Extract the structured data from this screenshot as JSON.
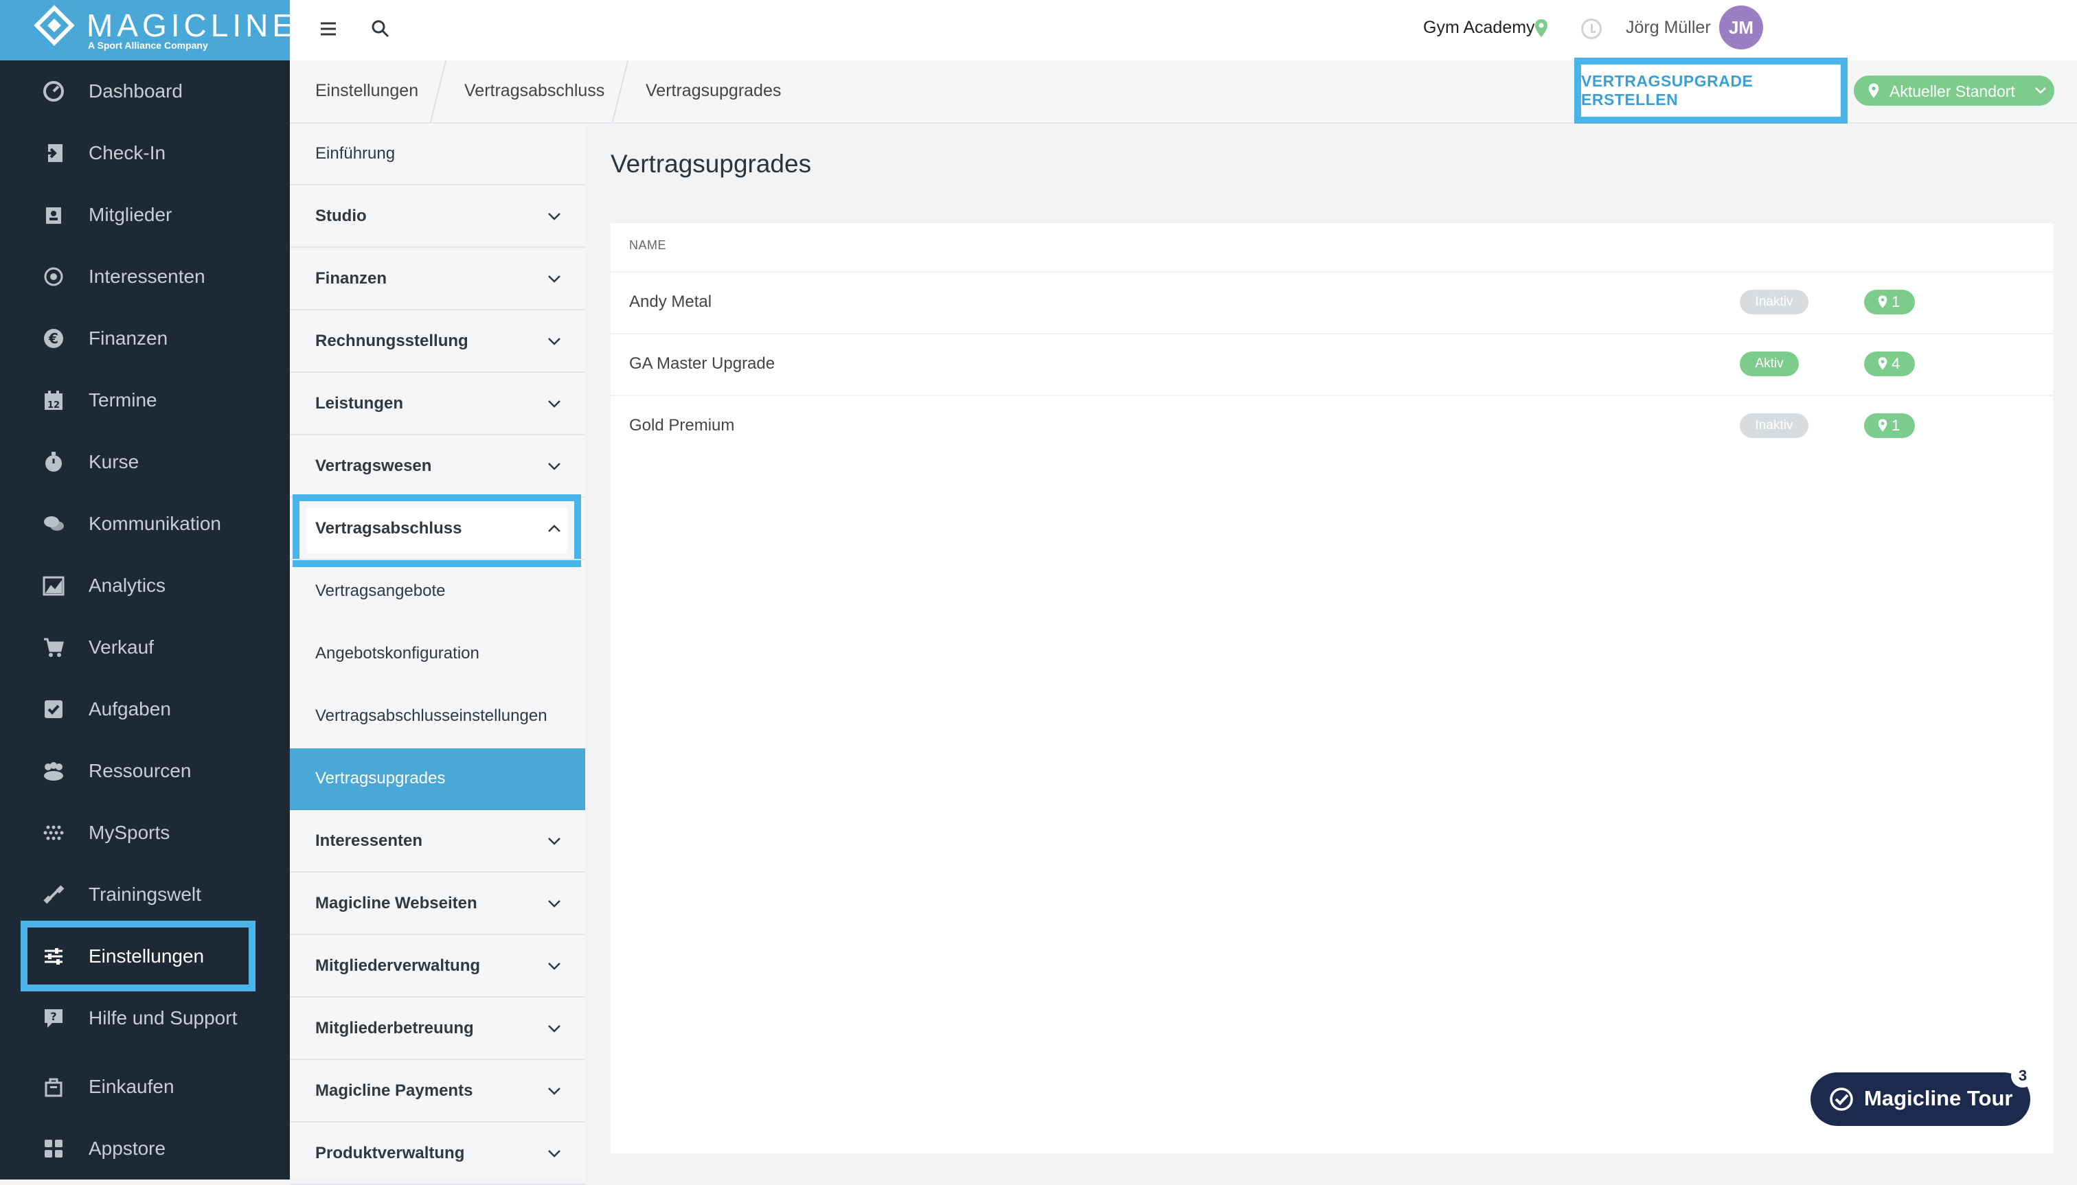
{
  "brand": {
    "name": "MAGICLINE",
    "tagline": "A Sport Alliance Company"
  },
  "sidebar": {
    "items": [
      {
        "label": "Dashboard",
        "icon": "dashboard-icon"
      },
      {
        "label": "Check-In",
        "icon": "check-in-icon"
      },
      {
        "label": "Mitglieder",
        "icon": "members-icon"
      },
      {
        "label": "Interessenten",
        "icon": "leads-icon"
      },
      {
        "label": "Finanzen",
        "icon": "euro-icon"
      },
      {
        "label": "Termine",
        "icon": "calendar-icon"
      },
      {
        "label": "Kurse",
        "icon": "stopwatch-icon"
      },
      {
        "label": "Kommunikation",
        "icon": "chat-icon"
      },
      {
        "label": "Analytics",
        "icon": "chart-icon"
      },
      {
        "label": "Verkauf",
        "icon": "cart-icon"
      },
      {
        "label": "Aufgaben",
        "icon": "checkbox-icon"
      },
      {
        "label": "Ressourcen",
        "icon": "group-icon"
      },
      {
        "label": "MySports",
        "icon": "dots-icon"
      },
      {
        "label": "Trainingswelt",
        "icon": "dumbbell-icon"
      },
      {
        "label": "Einstellungen",
        "icon": "sliders-icon",
        "active": true
      },
      {
        "label": "Hilfe und Support",
        "icon": "help-icon"
      },
      {
        "label": "Einkaufen",
        "icon": "shop-icon"
      },
      {
        "label": "Appstore",
        "icon": "grid-icon"
      }
    ]
  },
  "topbar": {
    "gym": "Gym Academy",
    "user": "Jörg Müller",
    "avatar_initials": "JM"
  },
  "breadcrumb": [
    "Einstellungen",
    "Vertragsabschluss",
    "Vertragsupgrades"
  ],
  "actions": {
    "create_label": "VERTRAGSUPGRADE ERSTELLEN",
    "location_label": "Aktueller Standort"
  },
  "submenu": {
    "items": [
      {
        "label": "Einführung",
        "type": "plain"
      },
      {
        "label": "Studio",
        "type": "group"
      },
      {
        "label": "Finanzen",
        "type": "group"
      },
      {
        "label": "Rechnungsstellung",
        "type": "group"
      },
      {
        "label": "Leistungen",
        "type": "group"
      },
      {
        "label": "Vertragswesen",
        "type": "group"
      },
      {
        "label": "Vertragsabschluss",
        "type": "group-open"
      },
      {
        "label": "Vertragsangebote",
        "type": "sub"
      },
      {
        "label": "Angebotskonfiguration",
        "type": "sub"
      },
      {
        "label": "Vertragsabschlusseinstellungen",
        "type": "sub"
      },
      {
        "label": "Vertragsupgrades",
        "type": "sub-selected"
      },
      {
        "label": "Interessenten",
        "type": "group"
      },
      {
        "label": "Magicline Webseiten",
        "type": "group"
      },
      {
        "label": "Mitgliederverwaltung",
        "type": "group"
      },
      {
        "label": "Mitgliederbetreuung",
        "type": "group"
      },
      {
        "label": "Magicline Payments",
        "type": "group"
      },
      {
        "label": "Produktverwaltung",
        "type": "group"
      }
    ]
  },
  "main": {
    "title": "Vertragsupgrades",
    "column_name": "NAME",
    "rows": [
      {
        "name": "Andy Metal",
        "status": "Inaktiv",
        "locations": "1"
      },
      {
        "name": "GA Master Upgrade",
        "status": "Aktiv",
        "locations": "4"
      },
      {
        "name": "Gold Premium",
        "status": "Inaktiv",
        "locations": "1"
      }
    ]
  },
  "tour": {
    "label": "Magicline Tour",
    "count": "3"
  },
  "colors": {
    "sidebar_bg": "#1d2a36",
    "brand_blue": "#4aa8d8",
    "highlight": "#4ab3ea",
    "green": "#7ccd8c",
    "inactive_gray": "#d9dcdf",
    "tour_navy": "#1b2a4d",
    "avatar_purple": "#9b7fc4"
  }
}
